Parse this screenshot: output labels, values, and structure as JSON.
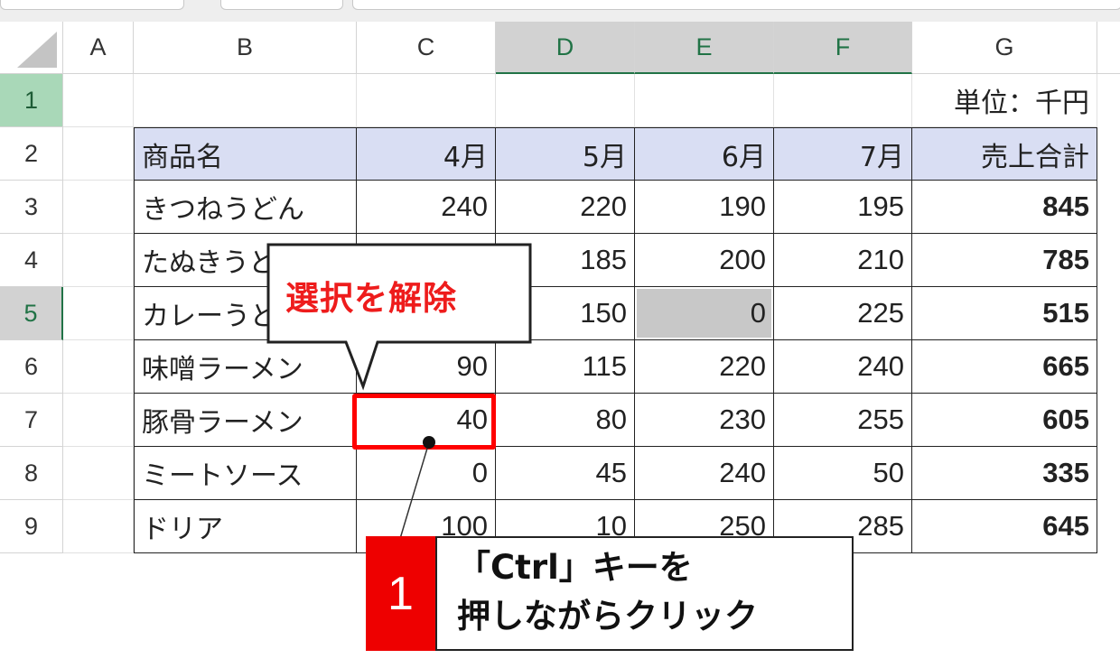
{
  "columns": [
    "A",
    "B",
    "C",
    "D",
    "E",
    "F",
    "G"
  ],
  "rows": [
    "1",
    "2",
    "3",
    "4",
    "5",
    "6",
    "7",
    "8",
    "9"
  ],
  "unit_label": "単位：千円",
  "table": {
    "headers": [
      "商品名",
      "4月",
      "5月",
      "6月",
      "7月",
      "売上合計"
    ],
    "rows": [
      {
        "name": "きつねうどん",
        "m4": "240",
        "m5": "220",
        "m6": "190",
        "m7": "195",
        "total": "845"
      },
      {
        "name": "たぬきうどん",
        "m4": "",
        "m5": "185",
        "m6": "200",
        "m7": "210",
        "total": "785"
      },
      {
        "name": "カレーうどん",
        "m4": "",
        "m5": "150",
        "m6": "0",
        "m7": "225",
        "total": "515"
      },
      {
        "name": "味噌ラーメン",
        "m4": "90",
        "m5": "115",
        "m6": "220",
        "m7": "240",
        "total": "665"
      },
      {
        "name": "豚骨ラーメン",
        "m4": "40",
        "m5": "80",
        "m6": "230",
        "m7": "255",
        "total": "605"
      },
      {
        "name": "ミートソース",
        "m4": "0",
        "m5": "45",
        "m6": "240",
        "m7": "50",
        "total": "335"
      },
      {
        "name": "ドリア",
        "m4": "100",
        "m5": "10",
        "m6": "250",
        "m7": "285",
        "total": "645"
      }
    ]
  },
  "callout": {
    "text": "選択を解除"
  },
  "step": {
    "number": "1",
    "line1": "「Ctrl」キーを",
    "line2": "押しながらクリック"
  },
  "colors": {
    "accent": "#217346",
    "highlight": "#ff0000",
    "header_fill": "#d9def3",
    "step_fill": "#ee0000"
  },
  "icons": [
    "select-all-triangle-icon"
  ]
}
